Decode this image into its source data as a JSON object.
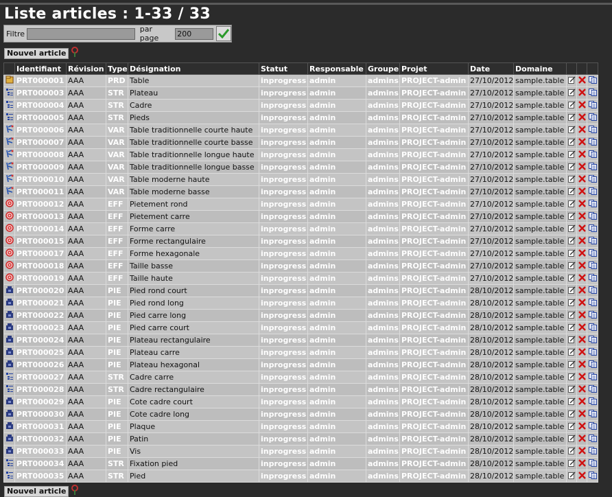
{
  "page": {
    "title": "Liste articles : 1-33 / 33"
  },
  "filter": {
    "filter_label": "Filtre",
    "filter_value": "",
    "per_page_label": "par page",
    "per_page_value": "200"
  },
  "actions": {
    "new_article_label": "Nouvel article"
  },
  "colors": {
    "background": "#2b2b2b",
    "row": "#c4c4c4",
    "link_text": "#ffffff",
    "delete": "#d01010",
    "ok": "#2a9a2a"
  },
  "table": {
    "headers": [
      "",
      "Identifiant",
      "Révision",
      "Type",
      "Désignation",
      "Statut",
      "Responsable",
      "Groupe",
      "Projet",
      "Date",
      "Domaine",
      "",
      "",
      ""
    ],
    "rows": [
      {
        "icon": "product-icon",
        "id": "PRT000001",
        "rev": "AAA",
        "type": "PRD",
        "designation": "Table",
        "status": "inprogress",
        "owner": "admin",
        "group": "admins",
        "project": "PROJECT-admin",
        "date": "27/10/2012",
        "domain": "sample.table"
      },
      {
        "icon": "structure-icon",
        "id": "PRT000003",
        "rev": "AAA",
        "type": "STR",
        "designation": "Plateau",
        "status": "inprogress",
        "owner": "admin",
        "group": "admins",
        "project": "PROJECT-admin",
        "date": "27/10/2012",
        "domain": "sample.table"
      },
      {
        "icon": "structure-icon",
        "id": "PRT000004",
        "rev": "AAA",
        "type": "STR",
        "designation": "Cadre",
        "status": "inprogress",
        "owner": "admin",
        "group": "admins",
        "project": "PROJECT-admin",
        "date": "27/10/2012",
        "domain": "sample.table"
      },
      {
        "icon": "structure-icon",
        "id": "PRT000005",
        "rev": "AAA",
        "type": "STR",
        "designation": "Pieds",
        "status": "inprogress",
        "owner": "admin",
        "group": "admins",
        "project": "PROJECT-admin",
        "date": "27/10/2012",
        "domain": "sample.table"
      },
      {
        "icon": "variant-icon",
        "id": "PRT000006",
        "rev": "AAA",
        "type": "VAR",
        "designation": "Table traditionnelle courte haute",
        "status": "inprogress",
        "owner": "admin",
        "group": "admins",
        "project": "PROJECT-admin",
        "date": "27/10/2012",
        "domain": "sample.table"
      },
      {
        "icon": "variant-icon",
        "id": "PRT000007",
        "rev": "AAA",
        "type": "VAR",
        "designation": "Table traditionnelle courte basse",
        "status": "inprogress",
        "owner": "admin",
        "group": "admins",
        "project": "PROJECT-admin",
        "date": "27/10/2012",
        "domain": "sample.table"
      },
      {
        "icon": "variant-icon",
        "id": "PRT000008",
        "rev": "AAA",
        "type": "VAR",
        "designation": "Table traditionnelle longue haute",
        "status": "inprogress",
        "owner": "admin",
        "group": "admins",
        "project": "PROJECT-admin",
        "date": "27/10/2012",
        "domain": "sample.table"
      },
      {
        "icon": "variant-icon",
        "id": "PRT000009",
        "rev": "AAA",
        "type": "VAR",
        "designation": "Table traditionnelle longue basse",
        "status": "inprogress",
        "owner": "admin",
        "group": "admins",
        "project": "PROJECT-admin",
        "date": "27/10/2012",
        "domain": "sample.table"
      },
      {
        "icon": "variant-icon",
        "id": "PRT000010",
        "rev": "AAA",
        "type": "VAR",
        "designation": "Table moderne haute",
        "status": "inprogress",
        "owner": "admin",
        "group": "admins",
        "project": "PROJECT-admin",
        "date": "27/10/2012",
        "domain": "sample.table"
      },
      {
        "icon": "variant-icon",
        "id": "PRT000011",
        "rev": "AAA",
        "type": "VAR",
        "designation": "Table moderne basse",
        "status": "inprogress",
        "owner": "admin",
        "group": "admins",
        "project": "PROJECT-admin",
        "date": "27/10/2012",
        "domain": "sample.table"
      },
      {
        "icon": "effectivity-icon",
        "id": "PRT000012",
        "rev": "AAA",
        "type": "EFF",
        "designation": "Pietement rond",
        "status": "inprogress",
        "owner": "admin",
        "group": "admins",
        "project": "PROJECT-admin",
        "date": "27/10/2012",
        "domain": "sample.table"
      },
      {
        "icon": "effectivity-icon",
        "id": "PRT000013",
        "rev": "AAA",
        "type": "EFF",
        "designation": "Pietement carre",
        "status": "inprogress",
        "owner": "admin",
        "group": "admins",
        "project": "PROJECT-admin",
        "date": "27/10/2012",
        "domain": "sample.table"
      },
      {
        "icon": "effectivity-icon",
        "id": "PRT000014",
        "rev": "AAA",
        "type": "EFF",
        "designation": "Forme carre",
        "status": "inprogress",
        "owner": "admin",
        "group": "admins",
        "project": "PROJECT-admin",
        "date": "27/10/2012",
        "domain": "sample.table"
      },
      {
        "icon": "effectivity-icon",
        "id": "PRT000015",
        "rev": "AAA",
        "type": "EFF",
        "designation": "Forme rectangulaire",
        "status": "inprogress",
        "owner": "admin",
        "group": "admins",
        "project": "PROJECT-admin",
        "date": "27/10/2012",
        "domain": "sample.table"
      },
      {
        "icon": "effectivity-icon",
        "id": "PRT000017",
        "rev": "AAA",
        "type": "EFF",
        "designation": "Forme hexagonale",
        "status": "inprogress",
        "owner": "admin",
        "group": "admins",
        "project": "PROJECT-admin",
        "date": "27/10/2012",
        "domain": "sample.table"
      },
      {
        "icon": "effectivity-icon",
        "id": "PRT000018",
        "rev": "AAA",
        "type": "EFF",
        "designation": "Taille basse",
        "status": "inprogress",
        "owner": "admin",
        "group": "admins",
        "project": "PROJECT-admin",
        "date": "27/10/2012",
        "domain": "sample.table"
      },
      {
        "icon": "effectivity-icon",
        "id": "PRT000019",
        "rev": "AAA",
        "type": "EFF",
        "designation": "Taille haute",
        "status": "inprogress",
        "owner": "admin",
        "group": "admins",
        "project": "PROJECT-admin",
        "date": "27/10/2012",
        "domain": "sample.table"
      },
      {
        "icon": "part-icon",
        "id": "PRT000020",
        "rev": "AAA",
        "type": "PIE",
        "designation": "Pied rond court",
        "status": "inprogress",
        "owner": "admin",
        "group": "admins",
        "project": "PROJECT-admin",
        "date": "28/10/2012",
        "domain": "sample.table"
      },
      {
        "icon": "part-icon",
        "id": "PRT000021",
        "rev": "AAA",
        "type": "PIE",
        "designation": "Pied rond long",
        "status": "inprogress",
        "owner": "admin",
        "group": "admins",
        "project": "PROJECT-admin",
        "date": "28/10/2012",
        "domain": "sample.table"
      },
      {
        "icon": "part-icon",
        "id": "PRT000022",
        "rev": "AAA",
        "type": "PIE",
        "designation": "Pied carre long",
        "status": "inprogress",
        "owner": "admin",
        "group": "admins",
        "project": "PROJECT-admin",
        "date": "28/10/2012",
        "domain": "sample.table"
      },
      {
        "icon": "part-icon",
        "id": "PRT000023",
        "rev": "AAA",
        "type": "PIE",
        "designation": "Pied carre court",
        "status": "inprogress",
        "owner": "admin",
        "group": "admins",
        "project": "PROJECT-admin",
        "date": "28/10/2012",
        "domain": "sample.table"
      },
      {
        "icon": "part-icon",
        "id": "PRT000024",
        "rev": "AAA",
        "type": "PIE",
        "designation": "Plateau rectangulaire",
        "status": "inprogress",
        "owner": "admin",
        "group": "admins",
        "project": "PROJECT-admin",
        "date": "28/10/2012",
        "domain": "sample.table"
      },
      {
        "icon": "part-icon",
        "id": "PRT000025",
        "rev": "AAA",
        "type": "PIE",
        "designation": "Plateau carre",
        "status": "inprogress",
        "owner": "admin",
        "group": "admins",
        "project": "PROJECT-admin",
        "date": "28/10/2012",
        "domain": "sample.table"
      },
      {
        "icon": "part-icon",
        "id": "PRT000026",
        "rev": "AAA",
        "type": "PIE",
        "designation": "Plateau hexagonal",
        "status": "inprogress",
        "owner": "admin",
        "group": "admins",
        "project": "PROJECT-admin",
        "date": "28/10/2012",
        "domain": "sample.table"
      },
      {
        "icon": "structure-icon",
        "id": "PRT000027",
        "rev": "AAA",
        "type": "STR",
        "designation": "Cadre carre",
        "status": "inprogress",
        "owner": "admin",
        "group": "admins",
        "project": "PROJECT-admin",
        "date": "28/10/2012",
        "domain": "sample.table"
      },
      {
        "icon": "structure-icon",
        "id": "PRT000028",
        "rev": "AAA",
        "type": "STR",
        "designation": "Cadre rectangulaire",
        "status": "inprogress",
        "owner": "admin",
        "group": "admins",
        "project": "PROJECT-admin",
        "date": "28/10/2012",
        "domain": "sample.table"
      },
      {
        "icon": "part-icon",
        "id": "PRT000029",
        "rev": "AAA",
        "type": "PIE",
        "designation": "Cote cadre court",
        "status": "inprogress",
        "owner": "admin",
        "group": "admins",
        "project": "PROJECT-admin",
        "date": "28/10/2012",
        "domain": "sample.table"
      },
      {
        "icon": "part-icon",
        "id": "PRT000030",
        "rev": "AAA",
        "type": "PIE",
        "designation": "Cote cadre long",
        "status": "inprogress",
        "owner": "admin",
        "group": "admins",
        "project": "PROJECT-admin",
        "date": "28/10/2012",
        "domain": "sample.table"
      },
      {
        "icon": "part-icon",
        "id": "PRT000031",
        "rev": "AAA",
        "type": "PIE",
        "designation": "Plaque",
        "status": "inprogress",
        "owner": "admin",
        "group": "admins",
        "project": "PROJECT-admin",
        "date": "28/10/2012",
        "domain": "sample.table"
      },
      {
        "icon": "part-icon",
        "id": "PRT000032",
        "rev": "AAA",
        "type": "PIE",
        "designation": "Patin",
        "status": "inprogress",
        "owner": "admin",
        "group": "admins",
        "project": "PROJECT-admin",
        "date": "28/10/2012",
        "domain": "sample.table"
      },
      {
        "icon": "part-icon",
        "id": "PRT000033",
        "rev": "AAA",
        "type": "PIE",
        "designation": "Vis",
        "status": "inprogress",
        "owner": "admin",
        "group": "admins",
        "project": "PROJECT-admin",
        "date": "28/10/2012",
        "domain": "sample.table"
      },
      {
        "icon": "structure-icon",
        "id": "PRT000034",
        "rev": "AAA",
        "type": "STR",
        "designation": "Fixation pied",
        "status": "inprogress",
        "owner": "admin",
        "group": "admins",
        "project": "PROJECT-admin",
        "date": "28/10/2012",
        "domain": "sample.table"
      },
      {
        "icon": "structure-icon",
        "id": "PRT000035",
        "rev": "AAA",
        "type": "STR",
        "designation": "Pied",
        "status": "inprogress",
        "owner": "admin",
        "group": "admins",
        "project": "PROJECT-admin",
        "date": "28/10/2012",
        "domain": "sample.table"
      }
    ]
  }
}
